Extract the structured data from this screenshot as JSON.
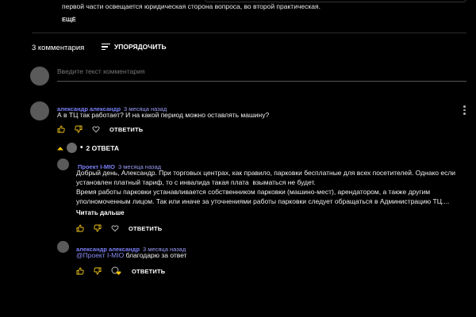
{
  "description": {
    "text_line": "первой части освещается юридическая сторона вопроса, во второй практическая.",
    "more_label": "ЕЩЁ"
  },
  "comments_header": {
    "count_label": "3 комментария",
    "sort_label": "УПОРЯДОЧИТЬ"
  },
  "comment_input": {
    "placeholder": "Введите текст комментария"
  },
  "comments": [
    {
      "author": "александр александр",
      "time": "3 месяца назад",
      "text": "А в ТЦ так работает? И на какой период можно оставлять машину?",
      "reply_label": "ОТВЕТИТЬ"
    }
  ],
  "replies_toggle": {
    "label": "2 ОТВЕТА"
  },
  "replies": [
    {
      "author": "Проект I-MIO",
      "time": "3 месяца назад",
      "lines": [
        "Добрый день, Александр. При торговых центрах, как правило, парковки бесплатные для всех посетителей. Однако если",
        "установлен платный тариф, то с инвалида такая плата  взыматься не будет.",
        "Время работы парковки устанавливается собственником парковки (машино-мест), арендатором, а также другим",
        "уполномоченным лицом. Так или иначе за уточнениями работы парковки следует обращаться в Администрацию ТЦ...."
      ],
      "read_more": "Читать дальше",
      "reply_label": "ОТВЕТИТЬ"
    },
    {
      "author": "александр александр",
      "time": "3 месяца назад",
      "mention": "@Проект I-MIO",
      "text": " благодарю за ответ",
      "reply_label": "ОТВЕТИТЬ"
    }
  ],
  "colors": {
    "background": "#000000",
    "author_link": "#7b7ff6",
    "heart_badge": "#f5c400"
  }
}
